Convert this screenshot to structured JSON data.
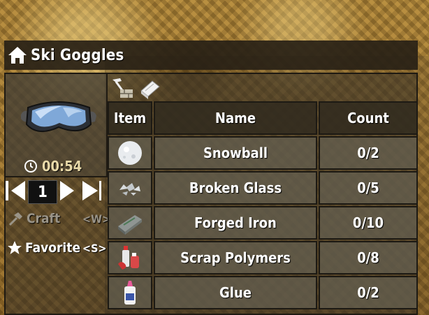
{
  "window": {
    "title": "Ski Goggles",
    "icon": "home-icon"
  },
  "recipe": {
    "craft_time": "00:54",
    "image": "ski-goggles-icon"
  },
  "quantity": {
    "value": "1"
  },
  "actions": {
    "craft": {
      "label": "Craft",
      "key": "<W>",
      "enabled": false
    },
    "favorite": {
      "label": "Favorite",
      "key": "<S>"
    }
  },
  "tabs": [
    {
      "icon": "workbench-tools-icon"
    },
    {
      "icon": "recipe-book-icon"
    }
  ],
  "ingredients": {
    "columns": [
      "Item",
      "Name",
      "Count"
    ],
    "rows": [
      {
        "icon": "snowball-icon",
        "name": "Snowball",
        "count": "0/2"
      },
      {
        "icon": "broken-glass-icon",
        "name": "Broken Glass",
        "count": "0/5"
      },
      {
        "icon": "forged-iron-icon",
        "name": "Forged Iron",
        "count": "0/10"
      },
      {
        "icon": "scrap-polymers-icon",
        "name": "Scrap Polymers",
        "count": "0/8"
      },
      {
        "icon": "glue-icon",
        "name": "Glue",
        "count": "0/2"
      }
    ]
  },
  "colors": {
    "header_text": "#ffffff",
    "timer_text": "#e8d9a8",
    "disabled_text": "#9a9488"
  }
}
